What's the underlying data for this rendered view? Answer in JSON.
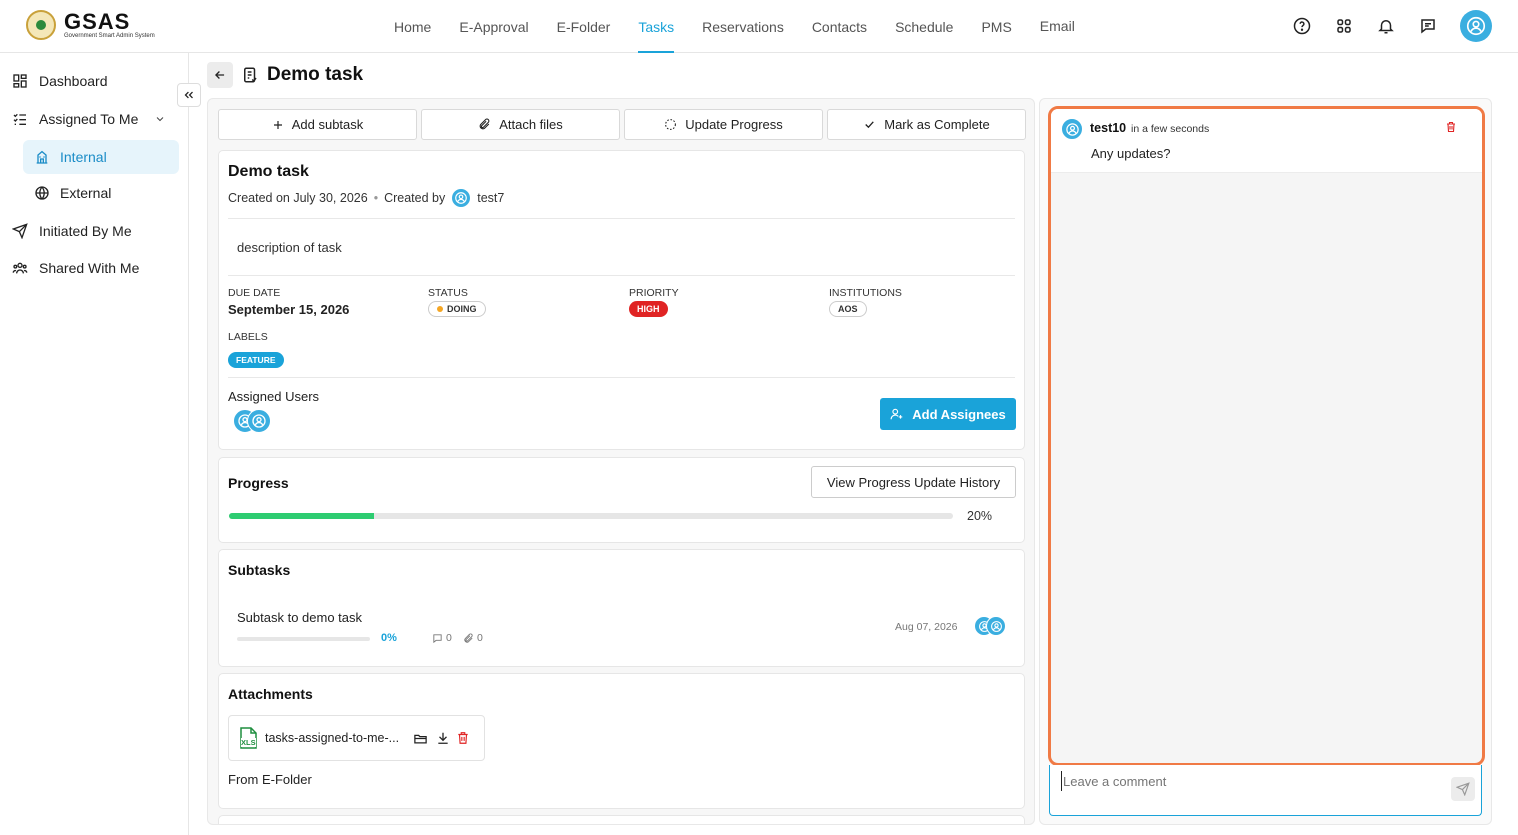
{
  "app": {
    "name": "GSAS",
    "subtitle": "Government Smart Admin System"
  },
  "nav": {
    "items": [
      "Home",
      "E-Approval",
      "E-Folder",
      "Tasks",
      "Reservations",
      "Contacts",
      "Schedule",
      "PMS",
      "Email"
    ],
    "active": "Tasks"
  },
  "sidebar": {
    "dashboard": "Dashboard",
    "assigned": "Assigned To Me",
    "internal": "Internal",
    "external": "External",
    "initiated": "Initiated By Me",
    "shared": "Shared With Me"
  },
  "page": {
    "title": "Demo task"
  },
  "actions": {
    "add_subtask": "Add subtask",
    "attach": "Attach files",
    "update": "Update Progress",
    "complete": "Mark as Complete"
  },
  "task": {
    "title": "Demo task",
    "created_on": "Created on July 30, 2026",
    "created_by_label": "Created by",
    "created_by": "test7",
    "description": "description of task",
    "due_label": "DUE DATE",
    "due": "September 15, 2026",
    "status_label": "STATUS",
    "status": "DOING",
    "priority_label": "PRIORITY",
    "priority": "HIGH",
    "inst_label": "INSTITUTIONS",
    "inst": "AOS",
    "labels_label": "LABELS",
    "label": "FEATURE",
    "assigned_label": "Assigned Users",
    "add_assignees": "Add Assignees"
  },
  "progress": {
    "title": "Progress",
    "history_btn": "View Progress Update History",
    "value": 20,
    "text": "20%"
  },
  "subtasks": {
    "title": "Subtasks",
    "items": [
      {
        "name": "Subtask to demo task",
        "progress": "0%",
        "comments": "0",
        "attachments": "0",
        "date": "Aug 07, 2026"
      }
    ]
  },
  "attachments": {
    "title": "Attachments",
    "file": "tasks-assigned-to-me-...",
    "file_type": "XLS",
    "from": "From E-Folder"
  },
  "comments": {
    "items": [
      {
        "user": "test10",
        "time": "in a few seconds",
        "text": "Any updates?"
      }
    ],
    "placeholder": "Leave a comment"
  },
  "colors": {
    "accent": "#1aa3d9",
    "danger": "#e02424",
    "success": "#2ecc71",
    "highlight": "#f07a45"
  }
}
